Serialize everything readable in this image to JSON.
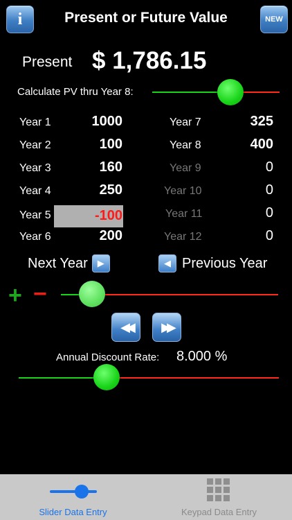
{
  "header": {
    "info_label": "i",
    "title": "Present or Future Value",
    "new_label": "NEW"
  },
  "present": {
    "label": "Present",
    "value": "$ 1,786.15"
  },
  "calc": {
    "label": "Calculate PV thru Year 8:",
    "fraction": 0.58
  },
  "years_left": [
    {
      "label": "Year 1",
      "value": "1000"
    },
    {
      "label": "Year 2",
      "value": "100"
    },
    {
      "label": "Year 3",
      "value": "160"
    },
    {
      "label": "Year 4",
      "value": "250"
    },
    {
      "label": "Year 5",
      "value": "-100"
    },
    {
      "label": "Year 6",
      "value": "200"
    }
  ],
  "years_right": [
    {
      "label": "Year 7",
      "value": "325"
    },
    {
      "label": "Year 8",
      "value": "400"
    },
    {
      "label": "Year 9",
      "value": "0"
    },
    {
      "label": "Year 10",
      "value": "0"
    },
    {
      "label": "Year 11",
      "value": "0"
    },
    {
      "label": "Year 12",
      "value": "0"
    }
  ],
  "nav": {
    "next_label": "Next Year",
    "prev_label": "Previous Year",
    "next_icon": "play-right-icon",
    "prev_icon": "play-left-icon"
  },
  "adjust": {
    "plus": "+",
    "minus": "−",
    "fraction": 0.14
  },
  "step": {
    "rewind_icon": "rewind-icon",
    "forward_icon": "fast-forward-icon"
  },
  "rate": {
    "label": "Annual Discount Rate:",
    "value": "8.000 %",
    "fraction": 0.34
  },
  "tabs": [
    {
      "label": "Slider Data Entry",
      "active": true
    },
    {
      "label": "Keypad Data Entry",
      "active": false
    }
  ],
  "colors": {
    "accent_green": "#18d318",
    "track_red": "#ff2a1a",
    "active_blue": "#1a73e8",
    "negative_red": "#ff1a1a"
  }
}
